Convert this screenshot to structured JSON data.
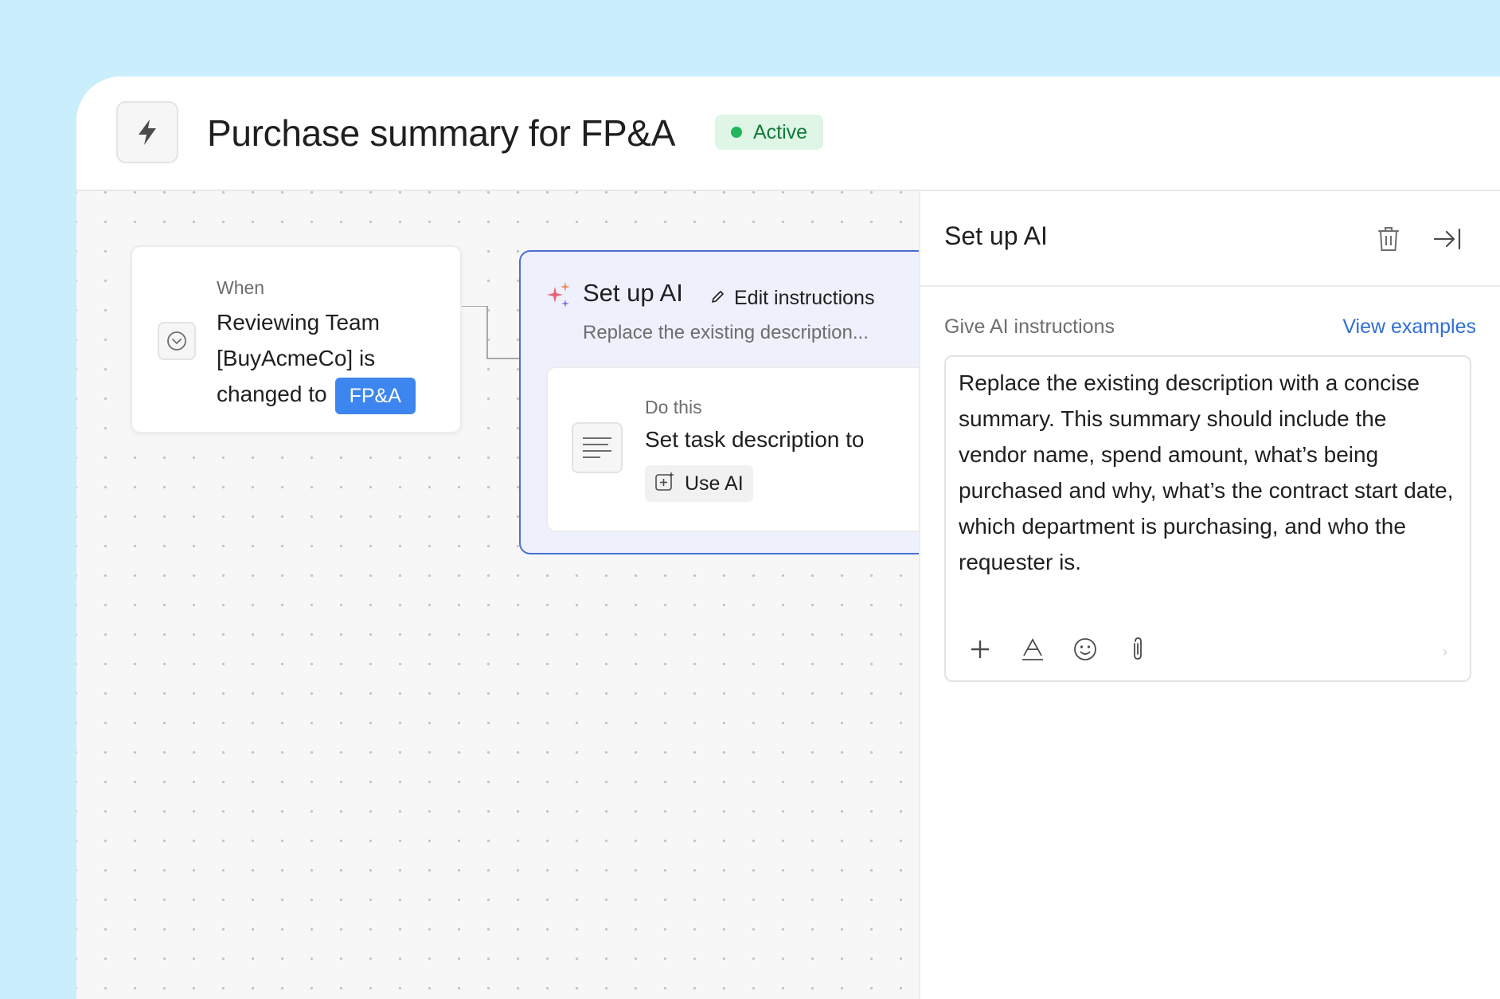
{
  "header": {
    "icon": "bolt-icon",
    "title": "Purchase summary for FP&A",
    "status": "Active",
    "status_color": "#23b559"
  },
  "when_card": {
    "label": "When",
    "text_prefix": "Reviewing Team [BuyAcmeCo] is changed to",
    "tag": "FP&A",
    "tag_color": "#3d86f0",
    "icon": "chevron-down-circle-icon"
  },
  "ai_step": {
    "icon": "sparkle-icon",
    "title": "Set up AI",
    "edit_label": "Edit instructions",
    "description": "Replace the existing description...",
    "accent_color": "#4b6fd1",
    "action": {
      "icon": "text-lines-icon",
      "label": "Do this",
      "text": "Set task description to",
      "chip_icon": "ai-plus-icon",
      "chip_label": "Use AI"
    }
  },
  "panel": {
    "title": "Set up AI",
    "delete_icon": "trash-icon",
    "collapse_icon": "collapse-right-icon",
    "instructions_label": "Give AI instructions",
    "view_examples": "View examples",
    "instructions_text": "Replace the existing description with a concise summary. This summary should include the vendor name, spend amount, what’s being purchased and why, what’s the contract start date, which department is purchasing, and who the requester is.",
    "toolbar": [
      "plus-icon",
      "text-format-icon",
      "emoji-icon",
      "attachment-icon"
    ]
  }
}
